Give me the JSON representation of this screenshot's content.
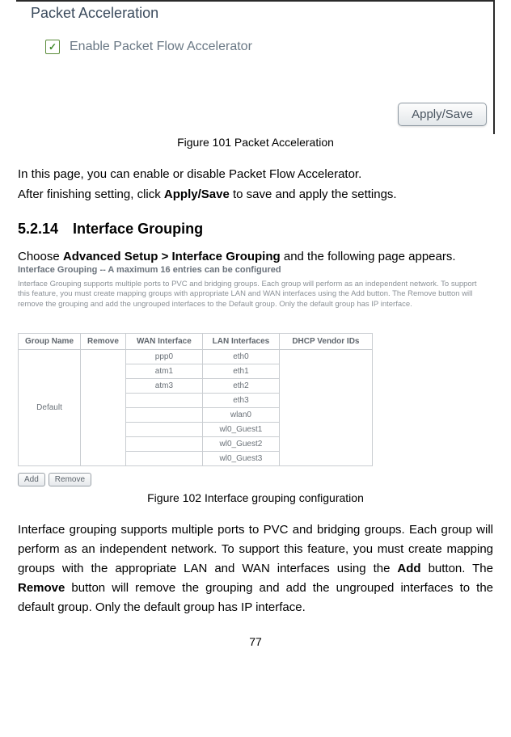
{
  "panel": {
    "title": "Packet Acceleration",
    "checkbox": {
      "checked_glyph": "✓",
      "label": "Enable Packet Flow Accelerator"
    },
    "apply_label": "Apply/Save"
  },
  "fig101": {
    "caption": "Figure 101 Packet Acceleration"
  },
  "intro": {
    "line1": "In this page, you can enable or disable Packet Flow Accelerator.",
    "line2_a": "After finishing setting, click ",
    "line2_b": "Apply/Save",
    "line2_c": " to save and apply the settings."
  },
  "section": {
    "number": "5.2.14",
    "title": "Interface Grouping"
  },
  "choose": {
    "pre": "Choose ",
    "path": "Advanced Setup > Interface Grouping",
    "post": " and the following page appears."
  },
  "grouping_shot": {
    "title": "Interface Grouping -- A maximum 16 entries can be configured",
    "hint": "Interface Grouping supports multiple ports to PVC and bridging groups. Each group will perform as an independent network. To support this feature, you must create mapping groups with appropriate LAN and WAN interfaces using the Add button. The Remove button will remove the grouping and add the ungrouped interfaces to the Default group. Only the default group has IP interface.",
    "headers": {
      "group": "Group Name",
      "remove": "Remove",
      "wan": "WAN Interface",
      "lan": "LAN Interfaces",
      "vendor": "DHCP Vendor IDs"
    },
    "group_name": "Default",
    "wan_rows": [
      "ppp0",
      "atm1",
      "atm3"
    ],
    "lan_rows": [
      "eth0",
      "eth1",
      "eth2",
      "eth3",
      "wlan0",
      "wl0_Guest1",
      "wl0_Guest2",
      "wl0_Guest3"
    ],
    "btn_add": "Add",
    "btn_remove": "Remove"
  },
  "fig102": {
    "caption": "Figure 102 Interface grouping configuration"
  },
  "para": {
    "p1": "Interface grouping supports multiple ports to PVC and bridging groups. Each group will perform as an independent network. To support this feature, you must create mapping groups with the appropriate LAN and WAN interfaces using the ",
    "p1b": "Add",
    "p2": " button. The ",
    "p2b": "Remove",
    "p3": " button will remove the grouping and add the ungrouped interfaces to the default group. Only the default group has IP interface."
  },
  "page_number": "77"
}
